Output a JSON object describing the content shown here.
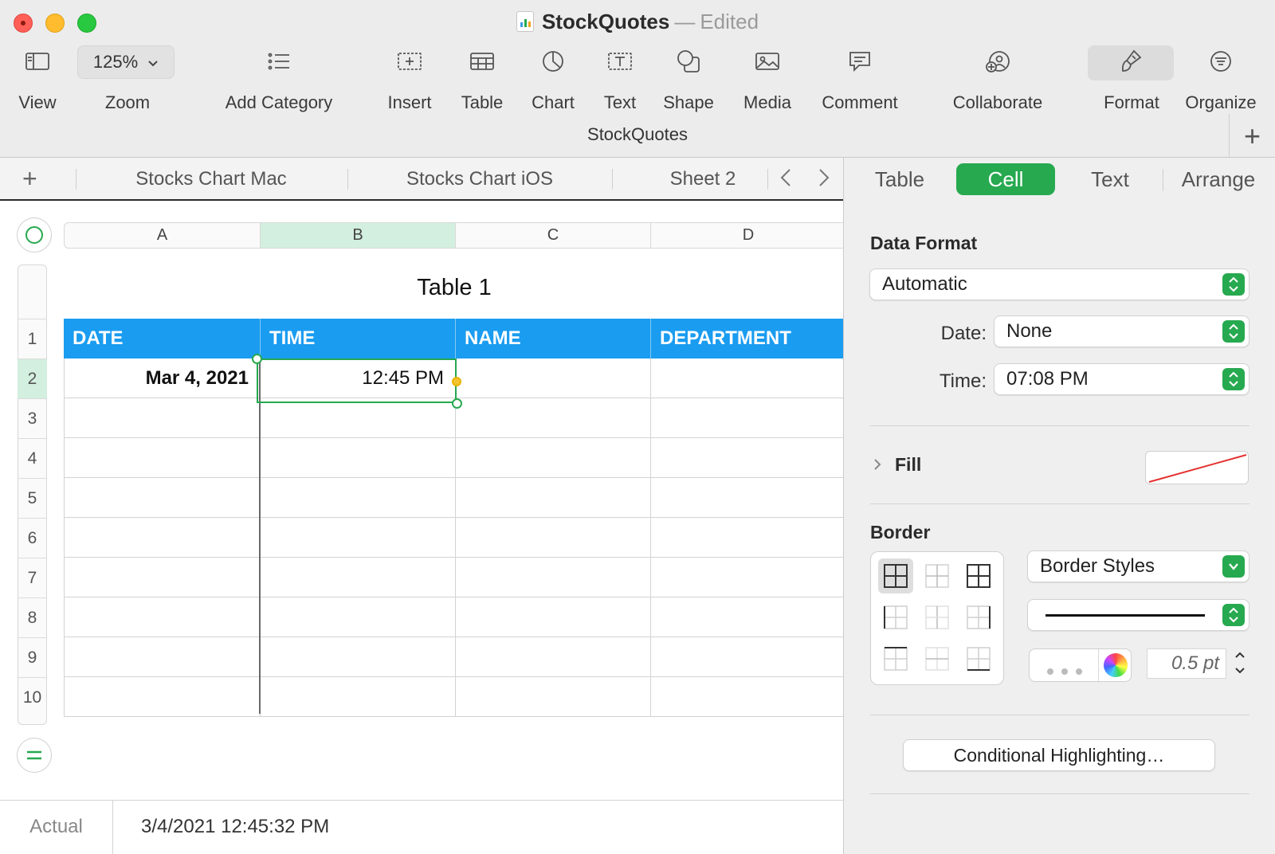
{
  "window": {
    "doc_name": "StockQuotes",
    "separator": "—",
    "status": "Edited",
    "window_name": "StockQuotes"
  },
  "toolbar": {
    "view": "View",
    "zoom_value": "125%",
    "zoom": "Zoom",
    "add_category": "Add Category",
    "insert": "Insert",
    "table": "Table",
    "chart": "Chart",
    "text": "Text",
    "shape": "Shape",
    "media": "Media",
    "comment": "Comment",
    "collaborate": "Collaborate",
    "format": "Format",
    "organize": "Organize"
  },
  "sheets": {
    "tabs": [
      "Stocks Chart Mac",
      "Stocks Chart iOS",
      "Sheet 2"
    ]
  },
  "inspector": {
    "tabs": [
      "Table",
      "Cell",
      "Text",
      "Arrange"
    ],
    "active_tab": "Cell",
    "data_format_heading": "Data Format",
    "data_format_value": "Automatic",
    "date_label": "Date:",
    "date_value": "None",
    "time_label": "Time:",
    "time_value": "07:08 PM",
    "fill_label": "Fill",
    "border_heading": "Border",
    "border_styles": "Border Styles",
    "border_width": "0.5 pt",
    "conditional_button": "Conditional Highlighting…",
    "accent_color": "#27a94f"
  },
  "spreadsheet": {
    "columns": [
      "A",
      "B",
      "C",
      "D"
    ],
    "selected_column": "B",
    "rows": [
      "1",
      "2",
      "3",
      "4",
      "5",
      "6",
      "7",
      "8",
      "9",
      "10"
    ],
    "selected_row": "2",
    "table_title": "Table 1",
    "headers": [
      "DATE",
      "TIME",
      "NAME",
      "DEPARTMENT"
    ],
    "header_color": "#1a9cf0",
    "row2": {
      "date": "Mar 4, 2021",
      "time": "12:45 PM"
    }
  },
  "formula_bar": {
    "label": "Actual",
    "value": "3/4/2021 12:45:32 PM"
  }
}
